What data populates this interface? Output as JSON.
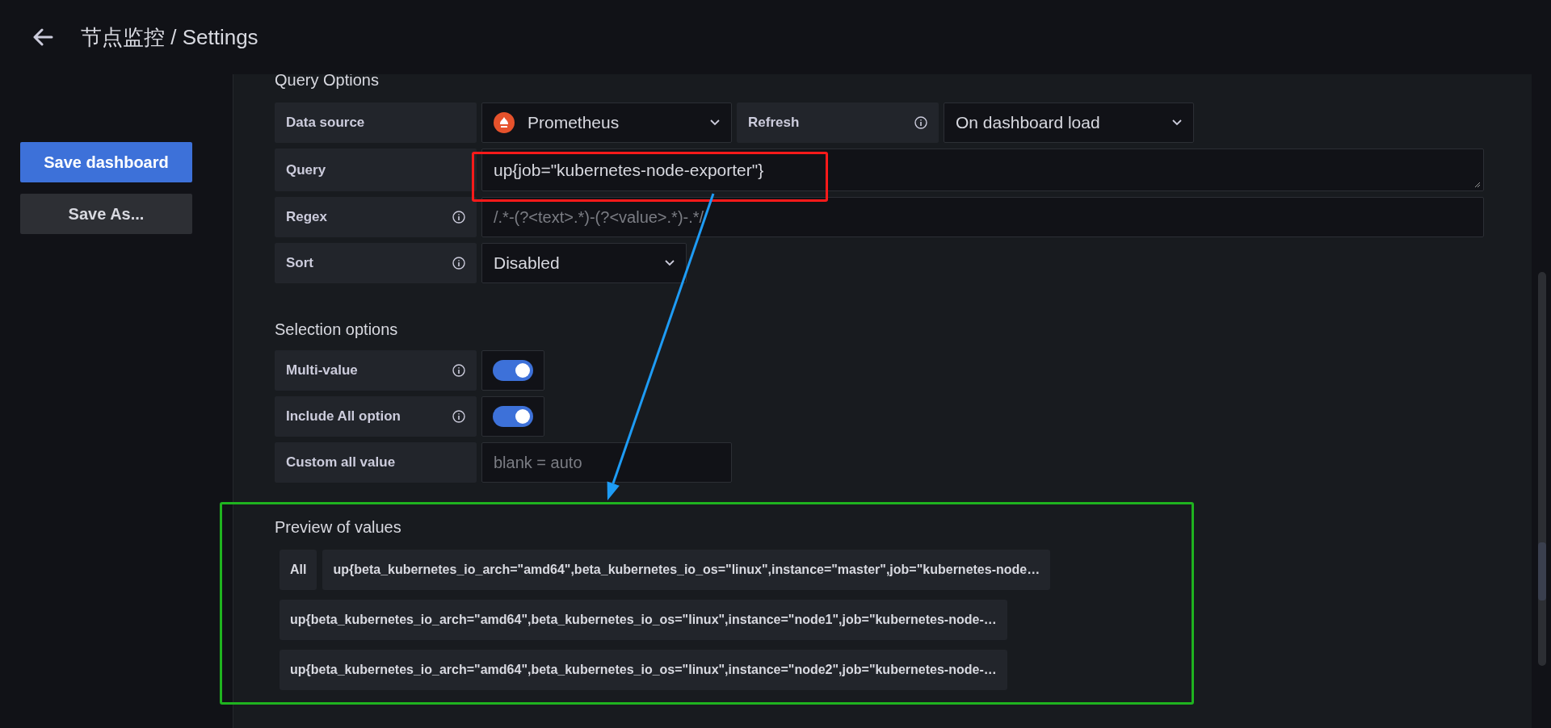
{
  "header": {
    "title": "节点监控 / Settings"
  },
  "sidebar": {
    "buttons": [
      {
        "label": "Save dashboard",
        "kind": "primary"
      },
      {
        "label": "Save As...",
        "kind": "secondary"
      }
    ]
  },
  "query_options": {
    "heading": "Query Options",
    "data_source": {
      "label": "Data source",
      "value": "Prometheus"
    },
    "refresh": {
      "label": "Refresh",
      "value": "On dashboard load"
    },
    "query": {
      "label": "Query",
      "value": "up{job=\"kubernetes-node-exporter\"}"
    },
    "regex": {
      "label": "Regex",
      "placeholder": "/.*-(?<text>.*)-(?<value>.*)-.*/"
    },
    "sort": {
      "label": "Sort",
      "value": "Disabled"
    }
  },
  "selection_options": {
    "heading": "Selection options",
    "multi_value": {
      "label": "Multi-value",
      "on": true
    },
    "include_all": {
      "label": "Include All option",
      "on": true
    },
    "custom_all_value": {
      "label": "Custom all value",
      "placeholder": "blank = auto"
    }
  },
  "preview": {
    "heading": "Preview of values",
    "values": [
      "All",
      "up{beta_kubernetes_io_arch=\"amd64\",beta_kubernetes_io_os=\"linux\",instance=\"master\",job=\"kubernetes-node…",
      "up{beta_kubernetes_io_arch=\"amd64\",beta_kubernetes_io_os=\"linux\",instance=\"node1\",job=\"kubernetes-node-…",
      "up{beta_kubernetes_io_arch=\"amd64\",beta_kubernetes_io_os=\"linux\",instance=\"node2\",job=\"kubernetes-node-…"
    ]
  }
}
